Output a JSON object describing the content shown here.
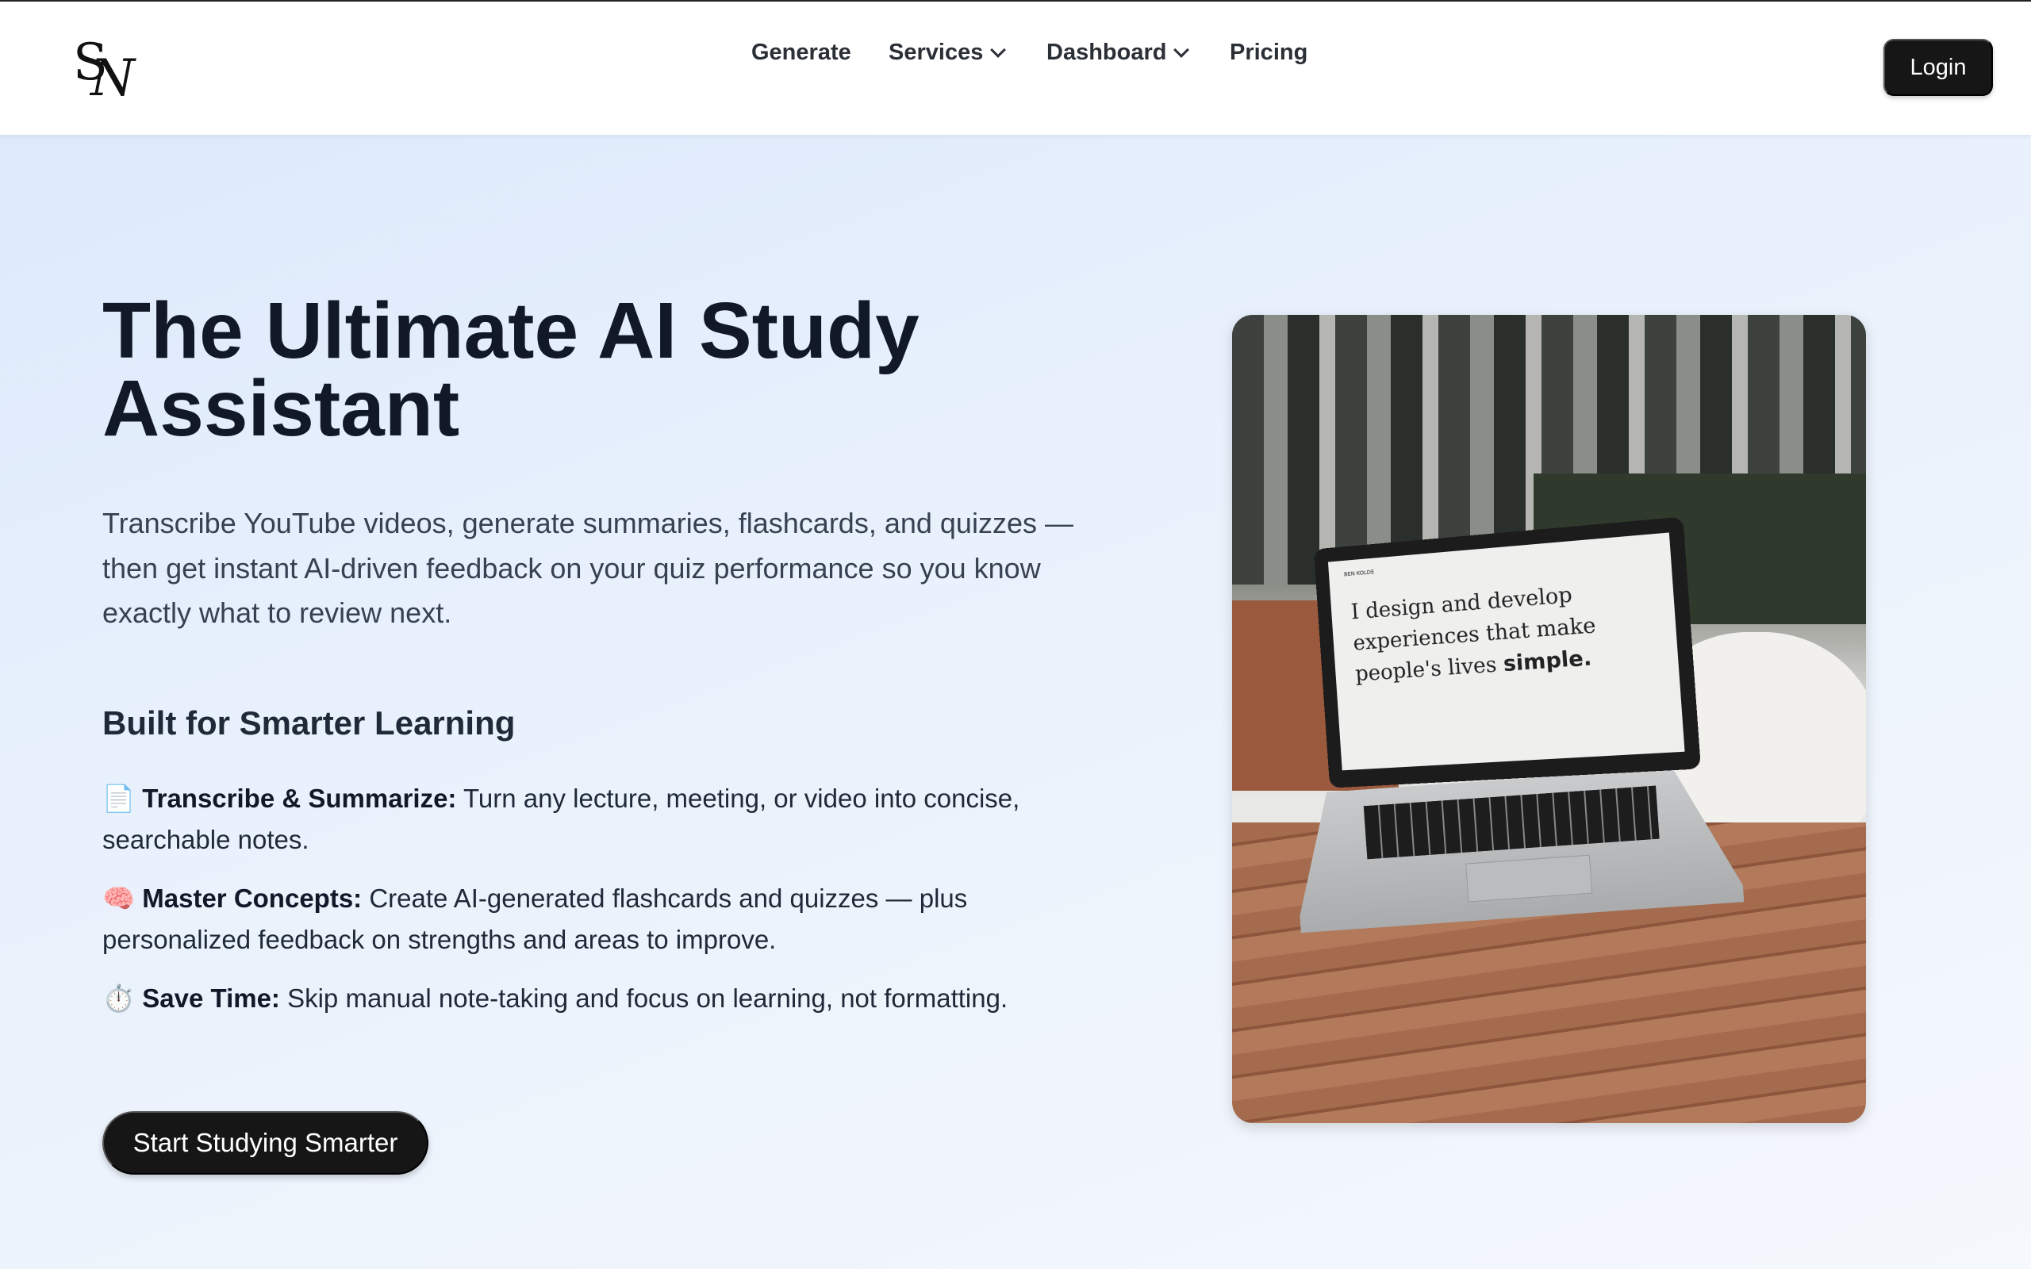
{
  "header": {
    "logo": {
      "letters": "SN"
    },
    "nav": [
      {
        "label": "Generate",
        "has_dropdown": false
      },
      {
        "label": "Services",
        "has_dropdown": true
      },
      {
        "label": "Dashboard",
        "has_dropdown": true
      },
      {
        "label": "Pricing",
        "has_dropdown": false
      }
    ],
    "login_label": "Login"
  },
  "hero": {
    "title": "The Ultimate AI Study Assistant",
    "description": "Transcribe YouTube videos, generate summaries, flashcards, and quizzes — then get instant AI-driven feedback on your quiz performance so you know exactly what to review next.",
    "subheading": "Built for Smarter Learning",
    "features": [
      {
        "icon": "📄",
        "icon_name": "document-icon",
        "title": "Transcribe & Summarize:",
        "text": "Turn any lecture, meeting, or video into concise, searchable notes."
      },
      {
        "icon": "🧠",
        "icon_name": "brain-icon",
        "title": "Master Concepts:",
        "text": "Create AI-generated flashcards and quizzes — plus personalized feedback on strengths and areas to improve."
      },
      {
        "icon": "⏱️",
        "icon_name": "stopwatch-icon",
        "title": "Save Time:",
        "text": "Skip manual note-taking and focus on learning, not formatting."
      }
    ],
    "cta_label": "Start Studying Smarter",
    "image": {
      "screen_text_main": "I design and develop experiences that make people's lives",
      "screen_text_bold": "simple.",
      "screen_brand": "BEN KOLDE"
    }
  },
  "colors": {
    "button_bg": "#161616",
    "text_dark": "#111827",
    "bg_gradient_start": "#dbe8fb",
    "bg_gradient_end": "#f5f8fd"
  }
}
